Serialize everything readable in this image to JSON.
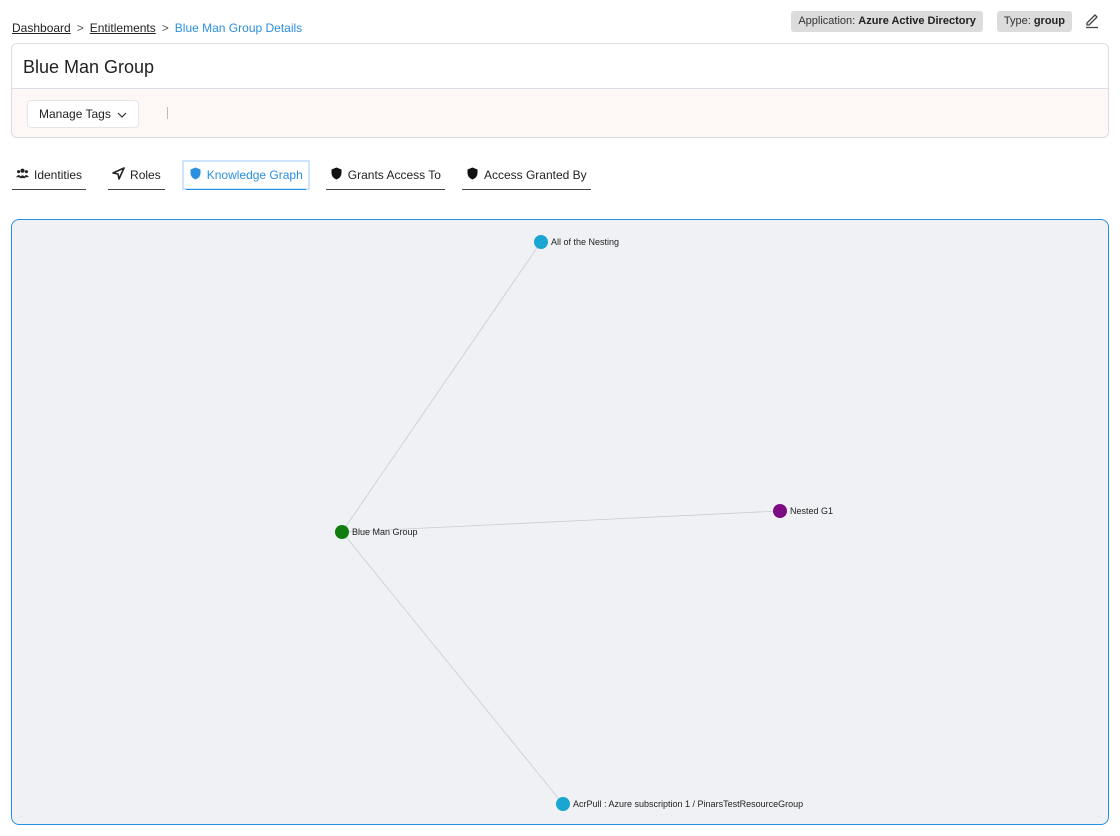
{
  "breadcrumb": {
    "items": [
      {
        "label": "Dashboard"
      },
      {
        "label": "Entitlements"
      }
    ],
    "separator": ">",
    "current": "Blue Man Group Details"
  },
  "meta": {
    "application_label": "Application:",
    "application_value": "Azure Active Directory",
    "type_label": "Type:",
    "type_value": "group",
    "edit_icon": "pencil-icon"
  },
  "header": {
    "title": "Blue Man Group",
    "manage_tags_label": "Manage Tags",
    "manage_tags_icon": "chevron-down-icon"
  },
  "tabs": [
    {
      "label": "Identities",
      "icon": "users-icon",
      "active": false
    },
    {
      "label": "Roles",
      "icon": "send-icon",
      "active": false
    },
    {
      "label": "Knowledge Graph",
      "icon": "shield-icon",
      "active": true
    },
    {
      "label": "Grants Access To",
      "icon": "shield-icon",
      "active": false
    },
    {
      "label": "Access Granted By",
      "icon": "shield-icon",
      "active": false
    }
  ],
  "graph": {
    "colors": {
      "entitlement": "#1ba6d2",
      "root": "#0e7d0e",
      "nested": "#7b0c82",
      "edge": "#c9ccd2",
      "active": "#2b8fe0"
    },
    "nodes": [
      {
        "id": "root",
        "label": "Blue Man Group",
        "kind": "root"
      },
      {
        "id": "n1",
        "label": "All of the Nesting",
        "kind": "entitlement"
      },
      {
        "id": "n2",
        "label": "Nested G1",
        "kind": "nested"
      },
      {
        "id": "n3",
        "label": "AcrPull : Azure subscription 1 / PinarsTestResourceGroup",
        "kind": "entitlement"
      }
    ],
    "edges": [
      {
        "from": "root",
        "to": "n1"
      },
      {
        "from": "root",
        "to": "n2"
      },
      {
        "from": "root",
        "to": "n3"
      }
    ]
  }
}
